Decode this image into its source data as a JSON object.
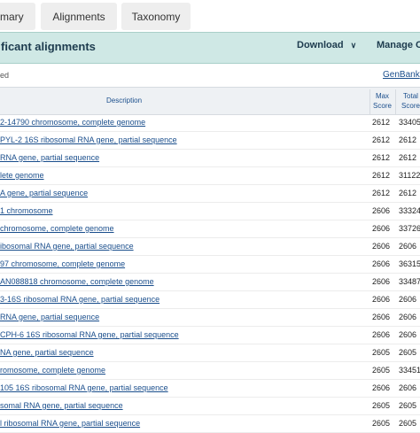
{
  "tabs": {
    "summary": "mary",
    "alignments": "Alignments",
    "taxonomy": "Taxonomy"
  },
  "header": {
    "title": "ficant alignments",
    "download": "Download",
    "manage": "Manage C"
  },
  "subbar": {
    "left_text": "ed",
    "genbank": "GenBank"
  },
  "table": {
    "col_description": "Description",
    "col_max": [
      "Max",
      "Score"
    ],
    "col_total": [
      "Total",
      "Score"
    ],
    "rows": [
      {
        "description": "2-14790 chromosome, complete genome",
        "max": "2612",
        "total": "33405"
      },
      {
        "description": "PYL-2 16S ribosomal RNA gene, partial sequence",
        "max": "2612",
        "total": "2612"
      },
      {
        "description": "RNA gene, partial sequence",
        "max": "2612",
        "total": "2612"
      },
      {
        "description": "lete genome",
        "max": "2612",
        "total": "31122"
      },
      {
        "description": "A gene, partial sequence",
        "max": "2612",
        "total": "2612"
      },
      {
        "description": "1 chromosome",
        "max": "2606",
        "total": "33324"
      },
      {
        "description": "chromosome, complete genome",
        "max": "2606",
        "total": "33726"
      },
      {
        "description": "ibosomal RNA gene, partial sequence",
        "max": "2606",
        "total": "2606"
      },
      {
        "description": "97 chromosome, complete genome",
        "max": "2606",
        "total": "36315"
      },
      {
        "description": "AN088818 chromosome, complete genome",
        "max": "2606",
        "total": "33487"
      },
      {
        "description": "3-16S ribosomal RNA gene, partial sequence",
        "max": "2606",
        "total": "2606"
      },
      {
        "description": "RNA gene, partial sequence",
        "max": "2606",
        "total": "2606"
      },
      {
        "description": "CPH-6 16S ribosomal RNA gene, partial sequence",
        "max": "2606",
        "total": "2606"
      },
      {
        "description": "NA gene, partial sequence",
        "max": "2605",
        "total": "2605"
      },
      {
        "description": "romosome, complete genome",
        "max": "2605",
        "total": "33451"
      },
      {
        "description": "105 16S ribosomal RNA gene, partial sequence",
        "max": "2606",
        "total": "2606"
      },
      {
        "description": "somal RNA gene, partial sequence",
        "max": "2605",
        "total": "2605"
      },
      {
        "description": "l ribosomal RNA gene, partial sequence",
        "max": "2605",
        "total": "2605"
      }
    ]
  }
}
